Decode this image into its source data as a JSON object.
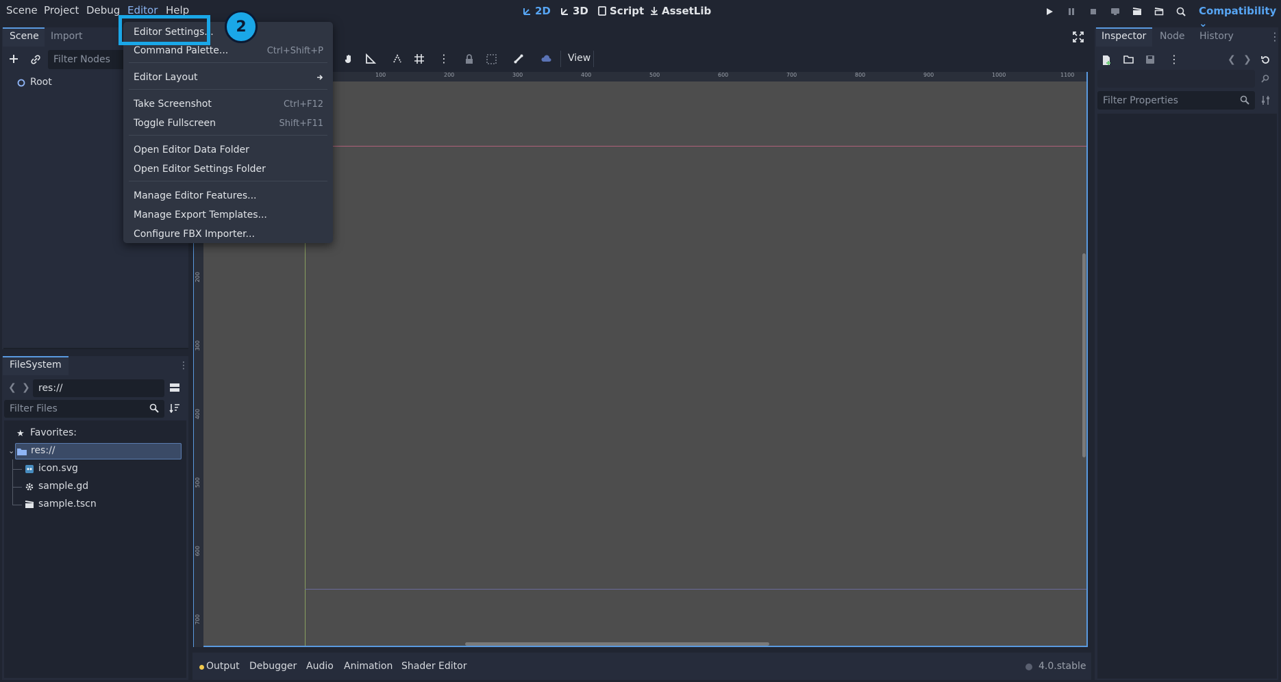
{
  "menubar": {
    "items": [
      "Scene",
      "Project",
      "Debug",
      "Editor",
      "Help"
    ]
  },
  "modes": {
    "two_d": "2D",
    "three_d": "3D",
    "script": "Script",
    "assetlib": "AssetLib"
  },
  "renderer": "Compatibility",
  "scene_dock": {
    "tabs": [
      "Scene",
      "Import"
    ],
    "filter_placeholder": "Filter Nodes",
    "root_label": "Root"
  },
  "filesystem": {
    "title": "FileSystem",
    "path": "res://",
    "filter_placeholder": "Filter Files",
    "favorites": "Favorites:",
    "root": "res://",
    "files": [
      "icon.svg",
      "sample.gd",
      "sample.tscn"
    ]
  },
  "viewport": {
    "view_label": "View",
    "ruler_h": [
      "100",
      "200",
      "300",
      "400",
      "500",
      "600",
      "700",
      "800",
      "900",
      "1000",
      "1100"
    ],
    "ruler_v": [
      "200",
      "300",
      "400",
      "500",
      "600",
      "700"
    ]
  },
  "bottom": {
    "tabs": [
      "Output",
      "Debugger",
      "Audio",
      "Animation",
      "Shader Editor"
    ],
    "version": "4.0.stable"
  },
  "inspector": {
    "tabs": [
      "Inspector",
      "Node",
      "History"
    ],
    "filter_placeholder": "Filter Properties"
  },
  "editor_menu": {
    "items": [
      {
        "label": "Editor Settings...",
        "shortcut": ""
      },
      {
        "label": "Command Palette...",
        "shortcut": "Ctrl+Shift+P"
      },
      {
        "label": "Editor Layout",
        "shortcut": ""
      },
      {
        "label": "Take Screenshot",
        "shortcut": "Ctrl+F12"
      },
      {
        "label": "Toggle Fullscreen",
        "shortcut": "Shift+F11"
      },
      {
        "label": "Open Editor Data Folder",
        "shortcut": ""
      },
      {
        "label": "Open Editor Settings Folder",
        "shortcut": ""
      },
      {
        "label": "Manage Editor Features...",
        "shortcut": ""
      },
      {
        "label": "Manage Export Templates...",
        "shortcut": ""
      },
      {
        "label": "Configure FBX Importer...",
        "shortcut": ""
      }
    ]
  },
  "annotation": {
    "step": "2"
  },
  "colors": {
    "accent": "#57a5f3",
    "highlight": "#1aa7e8",
    "viewport_bg": "#4d4d4d"
  }
}
